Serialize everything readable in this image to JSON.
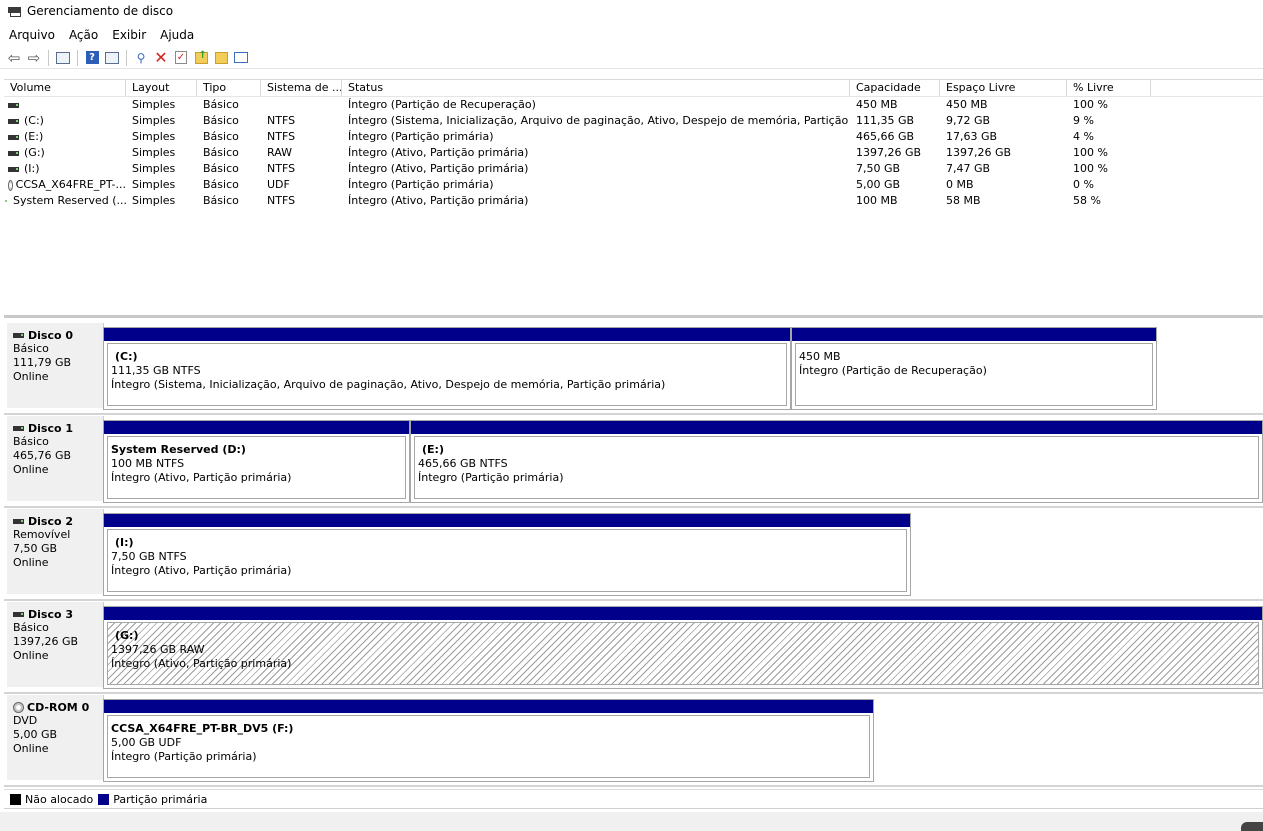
{
  "window": {
    "title": "Gerenciamento de disco"
  },
  "menu": [
    "Arquivo",
    "Ação",
    "Exibir",
    "Ajuda"
  ],
  "toolbar": {
    "icons": [
      "back-arrow-icon",
      "forward-arrow-icon",
      "console-tree-icon",
      "help-icon",
      "properties-icon",
      "connect-icon",
      "delete-icon",
      "check-icon",
      "open-folder-icon",
      "explore-icon",
      "window-icon"
    ]
  },
  "volume_list": {
    "headers": [
      "Volume",
      "Layout",
      "Tipo",
      "Sistema de ...",
      "Status",
      "Capacidade",
      "Espaço Livre",
      "% Livre"
    ],
    "rows": [
      {
        "volume": "",
        "layout": "Simples",
        "tipo": "Básico",
        "fs": "",
        "status": "Íntegro (Partição de Recuperação)",
        "cap": "450 MB",
        "free": "450 MB",
        "pct": "100 %",
        "icon": "drive-icon"
      },
      {
        "volume": "(C:)",
        "layout": "Simples",
        "tipo": "Básico",
        "fs": "NTFS",
        "status": "Íntegro (Sistema, Inicialização, Arquivo de paginação, Ativo, Despejo de memória, Partição primária)",
        "cap": "111,35 GB",
        "free": "9,72 GB",
        "pct": "9 %",
        "icon": "drive-icon"
      },
      {
        "volume": "(E:)",
        "layout": "Simples",
        "tipo": "Básico",
        "fs": "NTFS",
        "status": "Íntegro (Partição primária)",
        "cap": "465,66 GB",
        "free": "17,63 GB",
        "pct": "4 %",
        "icon": "drive-icon"
      },
      {
        "volume": "(G:)",
        "layout": "Simples",
        "tipo": "Básico",
        "fs": "RAW",
        "status": "Íntegro (Ativo, Partição primária)",
        "cap": "1397,26 GB",
        "free": "1397,26 GB",
        "pct": "100 %",
        "icon": "drive-icon"
      },
      {
        "volume": "(I:)",
        "layout": "Simples",
        "tipo": "Básico",
        "fs": "NTFS",
        "status": "Íntegro (Ativo, Partição primária)",
        "cap": "7,50 GB",
        "free": "7,47 GB",
        "pct": "100 %",
        "icon": "drive-icon"
      },
      {
        "volume": "CCSA_X64FRE_PT-...",
        "layout": "Simples",
        "tipo": "Básico",
        "fs": "UDF",
        "status": "Íntegro (Partição primária)",
        "cap": "5,00 GB",
        "free": "0 MB",
        "pct": "0 %",
        "icon": "cd-icon"
      },
      {
        "volume": "System Reserved (...",
        "layout": "Simples",
        "tipo": "Básico",
        "fs": "NTFS",
        "status": "Íntegro (Ativo, Partição primária)",
        "cap": "100 MB",
        "free": "58 MB",
        "pct": "58 %",
        "icon": "drive-icon"
      }
    ]
  },
  "disks": [
    {
      "name": "Disco 0",
      "type": "Básico",
      "size": "111,79 GB",
      "state": "Online",
      "icon": "drive-icon",
      "partitions": [
        {
          "label": "(C:)",
          "size_fs": "111,35 GB NTFS",
          "status": "Íntegro (Sistema, Inicialização, Arquivo de paginação, Ativo, Despejo de memória, Partição primária)",
          "hatched": false
        },
        {
          "label": "",
          "size_fs": "450 MB",
          "status": "Íntegro (Partição de Recuperação)",
          "hatched": false
        }
      ]
    },
    {
      "name": "Disco 1",
      "type": "Básico",
      "size": "465,76 GB",
      "state": "Online",
      "icon": "drive-icon",
      "partitions": [
        {
          "label": "System Reserved  (D:)",
          "size_fs": "100 MB NTFS",
          "status": "Íntegro (Ativo, Partição primária)",
          "hatched": false
        },
        {
          "label": "(E:)",
          "size_fs": "465,66 GB NTFS",
          "status": "Íntegro (Partição primária)",
          "hatched": false
        }
      ]
    },
    {
      "name": "Disco 2",
      "type": "Removível",
      "size": "7,50 GB",
      "state": "Online",
      "icon": "drive-icon",
      "partitions": [
        {
          "label": "(I:)",
          "size_fs": "7,50 GB NTFS",
          "status": "Íntegro (Ativo, Partição primária)",
          "hatched": false
        }
      ]
    },
    {
      "name": "Disco 3",
      "type": "Básico",
      "size": "1397,26 GB",
      "state": "Online",
      "icon": "drive-icon",
      "partitions": [
        {
          "label": "(G:)",
          "size_fs": "1397,26 GB RAW",
          "status": "Íntegro (Ativo, Partição primária)",
          "hatched": true
        }
      ]
    },
    {
      "name": "CD-ROM 0",
      "type": "DVD",
      "size": "5,00 GB",
      "state": "Online",
      "icon": "cd-icon",
      "partitions": [
        {
          "label": "CCSA_X64FRE_PT-BR_DV5  (F:)",
          "size_fs": "5,00 GB UDF",
          "status": "Íntegro (Partição primária)",
          "hatched": false
        }
      ]
    }
  ],
  "legend": [
    {
      "label": "Não alocado",
      "color": "#000000"
    },
    {
      "label": "Partição primária",
      "color": "#00008b"
    }
  ]
}
